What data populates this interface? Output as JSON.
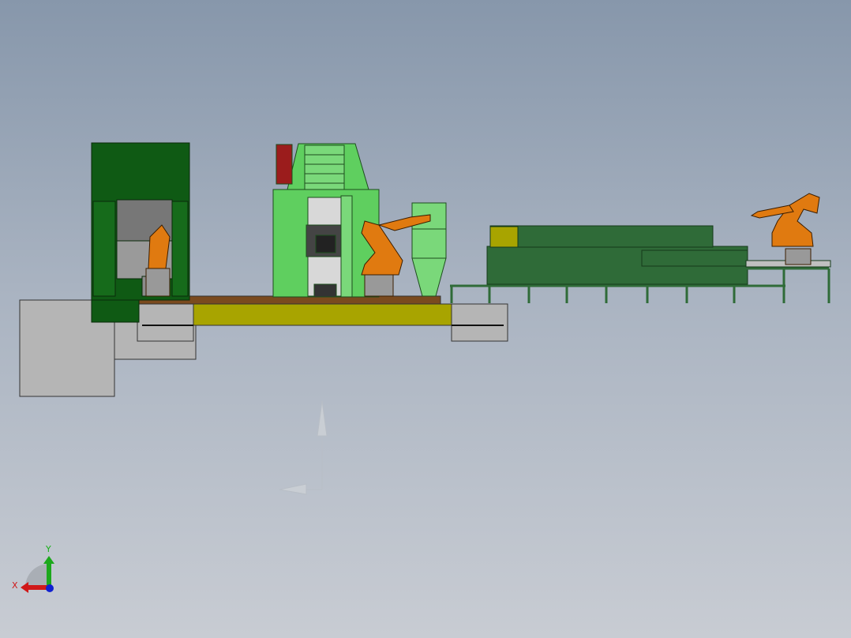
{
  "viewport": {
    "description_free": true,
    "triad": {
      "x_label": "X",
      "y_label": "Y"
    },
    "colors": {
      "press_green": "#0f5a14",
      "furnace_green": "#5fcf5f",
      "oven_green": "#2f6b38",
      "robot_orange": "#e07a10",
      "base_yellow": "#a8a400",
      "base_brown": "#7a4a1e",
      "foundation_gray": "#b5b5b5"
    }
  }
}
